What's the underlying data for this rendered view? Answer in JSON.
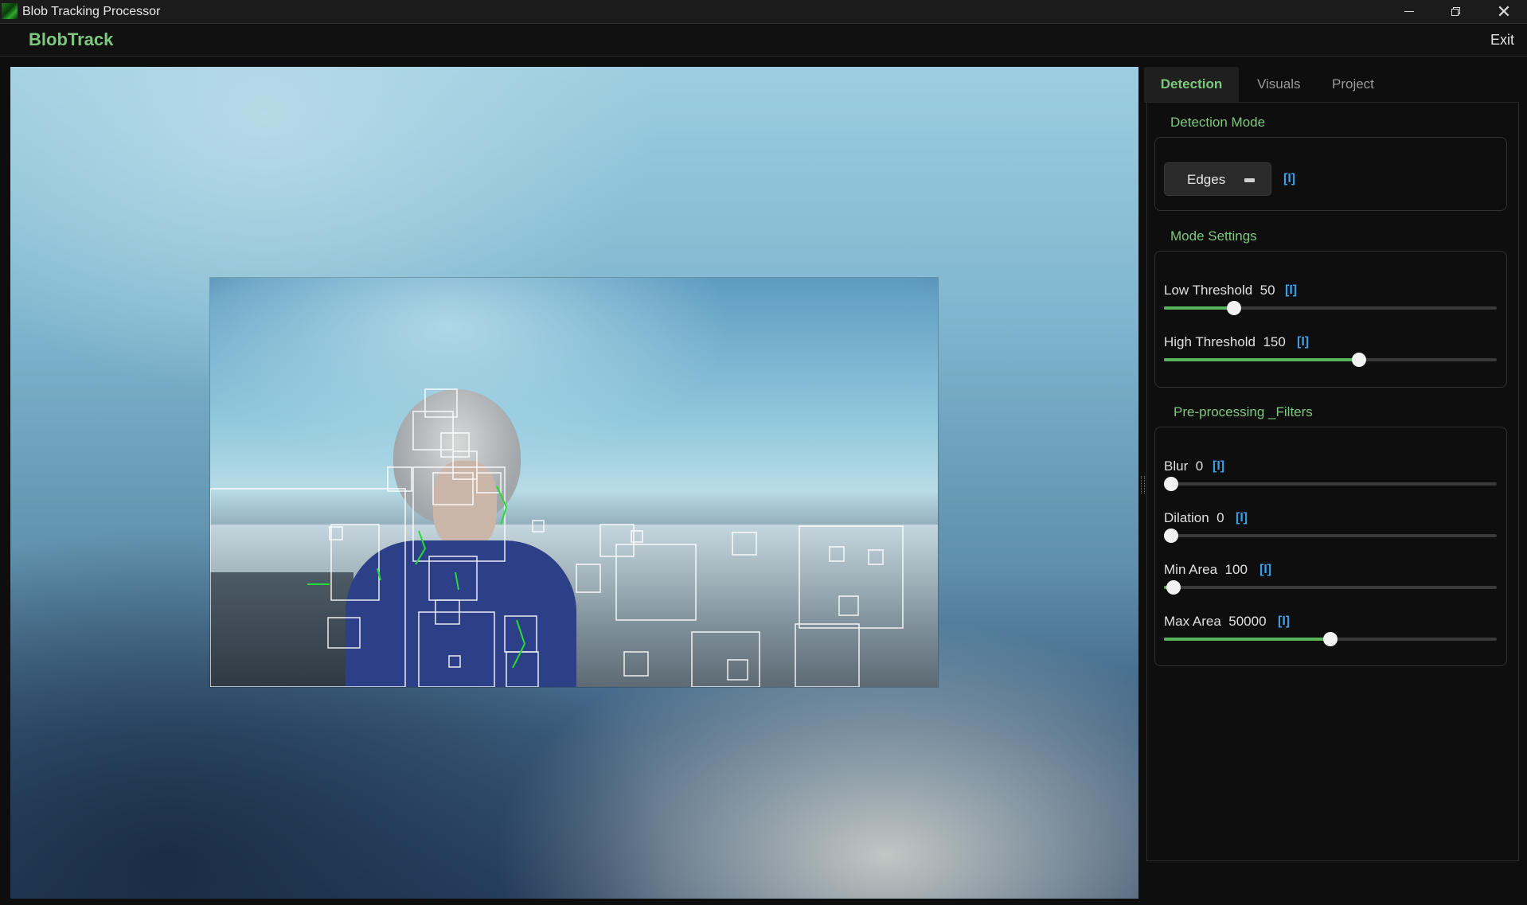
{
  "window": {
    "title": "Blob Tracking Processor",
    "icon": "blob-app-icon",
    "controls": [
      "minimize-icon",
      "restore-icon",
      "close-icon"
    ],
    "close_glyph": "✕"
  },
  "app": {
    "brand": "BlobTrack",
    "exit_label": "Exit",
    "accent": "#7ec87e",
    "info_color": "#3aa0e8"
  },
  "tabs": [
    {
      "label": "Detection",
      "active": true
    },
    {
      "label": "Visuals",
      "active": false
    },
    {
      "label": "Project",
      "active": false
    }
  ],
  "detection_mode": {
    "title": "Detection Mode",
    "selected": "Edges",
    "info": "[I]"
  },
  "mode_settings": {
    "title": "Mode Settings",
    "sliders": [
      {
        "name": "Low Threshold",
        "value": "50",
        "info": "[I]",
        "fraction": 0.21
      },
      {
        "name": "High Threshold",
        "value": "150",
        "info": "[I]",
        "fraction": 0.585
      }
    ]
  },
  "filters": {
    "title": "Pre-processing _Filters",
    "sliders": [
      {
        "name": "Blur",
        "value": "0",
        "info": "[I]",
        "fraction": 0.0
      },
      {
        "name": "Dilation",
        "value": "0",
        "info": "[I]",
        "fraction": 0.0
      },
      {
        "name": "Min Area",
        "value": "100",
        "info": "[I]",
        "fraction": 0.028
      },
      {
        "name": "Max Area",
        "value": "50000",
        "info": "[I]",
        "fraction": 0.5
      }
    ]
  }
}
